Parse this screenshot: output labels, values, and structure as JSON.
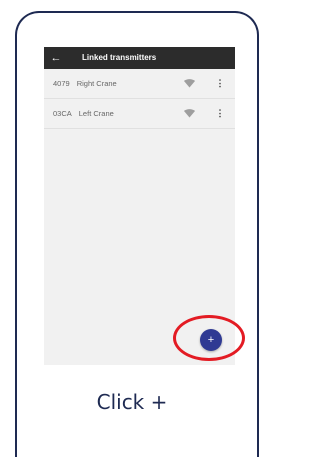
{
  "appbar": {
    "back_icon": "arrow-left-icon",
    "title": "Linked transmitters"
  },
  "transmitters": [
    {
      "code": "4079",
      "name": "Right Crane",
      "signal_icon": "wifi-icon",
      "menu_icon": "more-vert-icon"
    },
    {
      "code": "03CA",
      "name": "Left Crane",
      "signal_icon": "wifi-icon",
      "menu_icon": "more-vert-icon"
    }
  ],
  "fab": {
    "label": "+"
  },
  "caption": "Click +",
  "colors": {
    "frame": "#1e2a52",
    "appbar": "#2c2c2c",
    "fab": "#2f3a93",
    "highlight": "#e31b23"
  }
}
